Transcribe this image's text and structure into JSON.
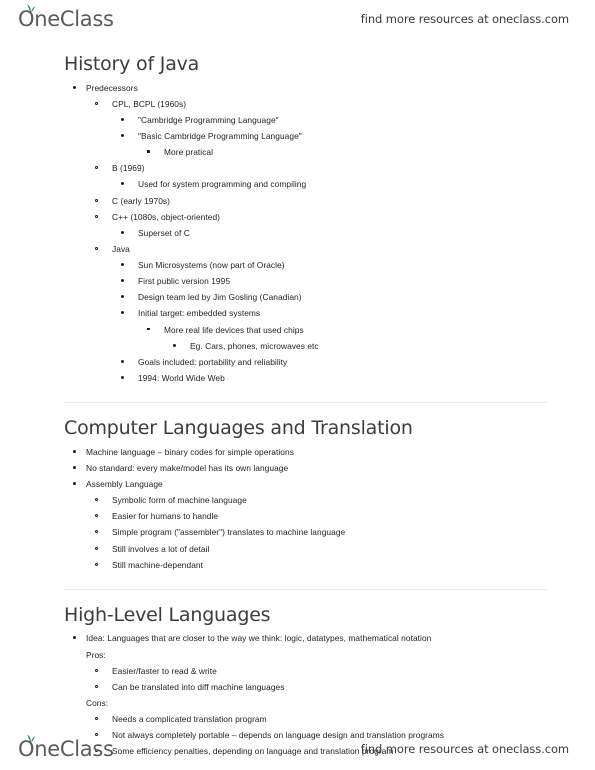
{
  "brand": {
    "logo_text": "OneClass",
    "logo_icon": "sprout-leaf-icon",
    "promo_text": "find more resources at oneclass.com",
    "accent_color": "#2e8b57",
    "logo_color": "#5b5b5b"
  },
  "sections": [
    {
      "title": "History of Java",
      "items": [
        {
          "level": 1,
          "marker": "disc",
          "text": "Predecessors",
          "children": [
            {
              "level": 2,
              "marker": "circle",
              "text": "CPL, BCPL (1960s)",
              "children": [
                {
                  "level": 3,
                  "marker": "disc",
                  "text": "\"Cambridge Programming Language\"",
                  "children": []
                },
                {
                  "level": 3,
                  "marker": "disc",
                  "text": "\"Basic Cambridge Programming Language\"",
                  "children": [
                    {
                      "level": 4,
                      "marker": "square",
                      "text": "More pratical",
                      "children": []
                    }
                  ]
                }
              ]
            },
            {
              "level": 2,
              "marker": "circle",
              "text": "B (1969)",
              "children": [
                {
                  "level": 3,
                  "marker": "disc",
                  "text": "Used for system programming and compiling",
                  "children": []
                }
              ]
            },
            {
              "level": 2,
              "marker": "circle",
              "text": "C (early 1970s)",
              "children": []
            },
            {
              "level": 2,
              "marker": "circle",
              "text": "C++ (1080s, object-oriented)",
              "children": [
                {
                  "level": 3,
                  "marker": "disc",
                  "text": "Superset of C",
                  "children": []
                }
              ]
            },
            {
              "level": 2,
              "marker": "circle",
              "text": "Java",
              "children": [
                {
                  "level": 3,
                  "marker": "disc",
                  "text": "Sun Microsystems (now part of Oracle)",
                  "children": []
                },
                {
                  "level": 3,
                  "marker": "disc",
                  "text": "First public version 1995",
                  "children": []
                },
                {
                  "level": 3,
                  "marker": "disc",
                  "text": "Design team led by Jim Gosling (Canadian)",
                  "children": []
                },
                {
                  "level": 3,
                  "marker": "disc",
                  "text": "Initial target: embedded systems",
                  "children": [
                    {
                      "level": 4,
                      "marker": "square",
                      "text": "More real life devices that used chips",
                      "children": [
                        {
                          "level": 5,
                          "marker": "disc",
                          "text": "Eg. Cars, phones, microwaves etc",
                          "children": []
                        }
                      ]
                    }
                  ]
                },
                {
                  "level": 3,
                  "marker": "disc",
                  "text": "Goals included: portability and reliability",
                  "children": []
                },
                {
                  "level": 3,
                  "marker": "disc",
                  "text": "1994: World Wide Web",
                  "children": []
                }
              ]
            }
          ]
        }
      ]
    },
    {
      "title": "Computer Languages and Translation",
      "items": [
        {
          "level": 1,
          "marker": "disc",
          "text": "Machine language – binary codes for simple operations",
          "children": []
        },
        {
          "level": 1,
          "marker": "disc",
          "text": "No standard: every make/model has its own language",
          "children": []
        },
        {
          "level": 1,
          "marker": "disc",
          "text": "Assembly Language",
          "children": [
            {
              "level": 2,
              "marker": "circle",
              "text": "Symbolic form of machine language",
              "children": []
            },
            {
              "level": 2,
              "marker": "circle",
              "text": "Easier for humans to handle",
              "children": []
            },
            {
              "level": 2,
              "marker": "circle",
              "text": "Simple program (\"assembler\") translates to machine language",
              "children": []
            },
            {
              "level": 2,
              "marker": "circle",
              "text": "Still involves a lot of detail",
              "children": []
            },
            {
              "level": 2,
              "marker": "circle",
              "text": "Still machine-dependant",
              "children": []
            }
          ]
        }
      ]
    },
    {
      "title": "High-Level Languages",
      "items": [
        {
          "level": 1,
          "marker": "disc",
          "text": "Idea: Languages that are closer to the way we think: logic, datatypes, mathematical notation",
          "trailing_plain": "Pros:",
          "children": [
            {
              "level": 2,
              "marker": "circle",
              "text": "Easier/faster to read & write",
              "children": []
            },
            {
              "level": 2,
              "marker": "circle",
              "text": "Can be translated into diff machine languages",
              "children": []
            }
          ]
        },
        {
          "level": 1,
          "marker": "none",
          "text": "Cons:",
          "plain": true,
          "children": [
            {
              "level": 2,
              "marker": "circle",
              "text": "Needs a complicated translation program",
              "children": []
            },
            {
              "level": 2,
              "marker": "circle",
              "text": "Not always completely portable – depends on language design and translation programs",
              "children": []
            },
            {
              "level": 2,
              "marker": "circle",
              "text": "Some efficiency penalties, depending on language and translation program",
              "children": []
            }
          ]
        }
      ]
    }
  ]
}
